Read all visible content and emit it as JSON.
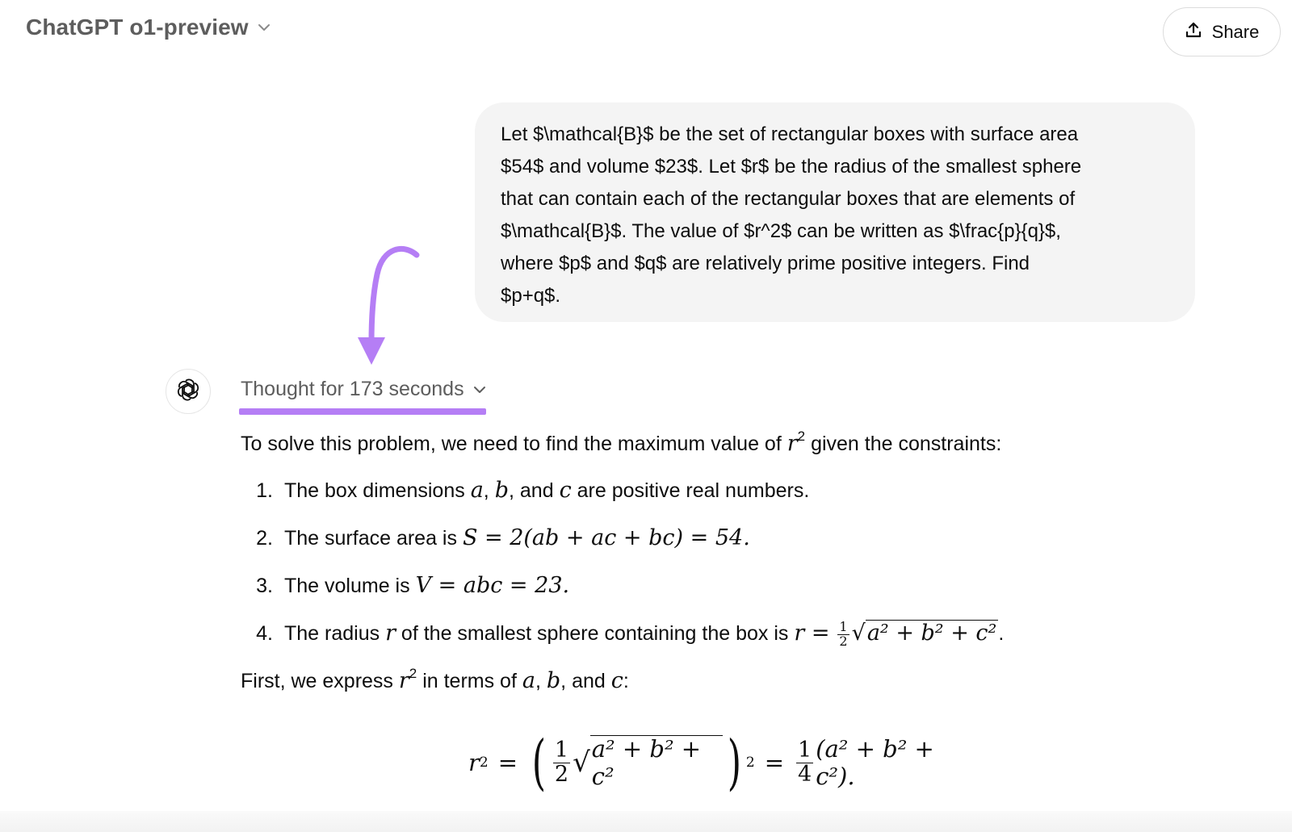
{
  "header": {
    "model_name": "ChatGPT o1-preview",
    "share_label": "Share",
    "icons": {
      "model_chevron": "chevron-down-icon",
      "share": "upload-share-icon"
    }
  },
  "user_message": {
    "text": "Let $\\mathcal{B}$ be the set of rectangular boxes with surface area $54$ and volume $23$. Let $r$ be the radius of the smallest sphere that can contain each of the rectangular boxes that are elements of $\\mathcal{B}$. The value of $r^2$ can be written as $\\frac{p}{q}$, where $p$ and $q$ are relatively prime positive integers. Find $p+q$.",
    "lines": [
      "Let $\\mathcal{B}$ be the set of rectangular boxes with surface area",
      "$54$ and volume $23$. Let $r$ be the radius of the smallest sphere",
      "that can contain each of the rectangular boxes that are elements of",
      "$\\mathcal{B}$. The value of $r^2$ can be written as $\\frac{p}{q}$,",
      "where $p$ and $q$ are relatively prime positive integers. Find",
      "$p+q$."
    ]
  },
  "annotation": {
    "arrow_color": "#b57ef5",
    "underline_color": "#b57ef5",
    "icon": "curved-arrow-down-icon"
  },
  "assistant": {
    "avatar_icon": "openai-logo-icon",
    "thought_label": "Thought for 173 seconds",
    "intro": {
      "before": "To solve this problem, we need to find the maximum value of ",
      "var": "r",
      "sup": "2",
      "after": " given the constraints:"
    },
    "constraints": [
      {
        "num": "1.",
        "text_a": "The box dimensions ",
        "a": "a",
        "sep1": ", ",
        "b": "b",
        "sep2": ", and ",
        "c": "c",
        "text_b": " are positive real numbers."
      },
      {
        "num": "2.",
        "text": "The surface area is ",
        "math": "S = 2(ab + ac + bc) = 54."
      },
      {
        "num": "3.",
        "text": "The volume is ",
        "math": "V = abc = 23."
      },
      {
        "num": "4.",
        "text_a": "The radius ",
        "r": "r",
        "text_b": " of the smallest sphere containing the box is ",
        "math_lhs": "r =",
        "frac_n": "1",
        "frac_d": "2",
        "sqrt_body": "a² + b² + c²",
        "end": "."
      }
    ],
    "first_para": {
      "before": "First, we express ",
      "var": "r",
      "sup": "2",
      "mid": " in terms of ",
      "a": "a",
      "sep1": ", ",
      "b": "b",
      "sep2": ", and ",
      "c": "c",
      "end": ":"
    },
    "display_equation": {
      "lhs": "r",
      "lhs_sup": "2",
      "eq1": "=",
      "frac1_n": "1",
      "frac1_d": "2",
      "sqrt_body": "a² + b² + c²",
      "outer_sup": "2",
      "eq2": "=",
      "frac2_n": "1",
      "frac2_d": "4",
      "rhs": "(a² + b² + c²)."
    }
  }
}
